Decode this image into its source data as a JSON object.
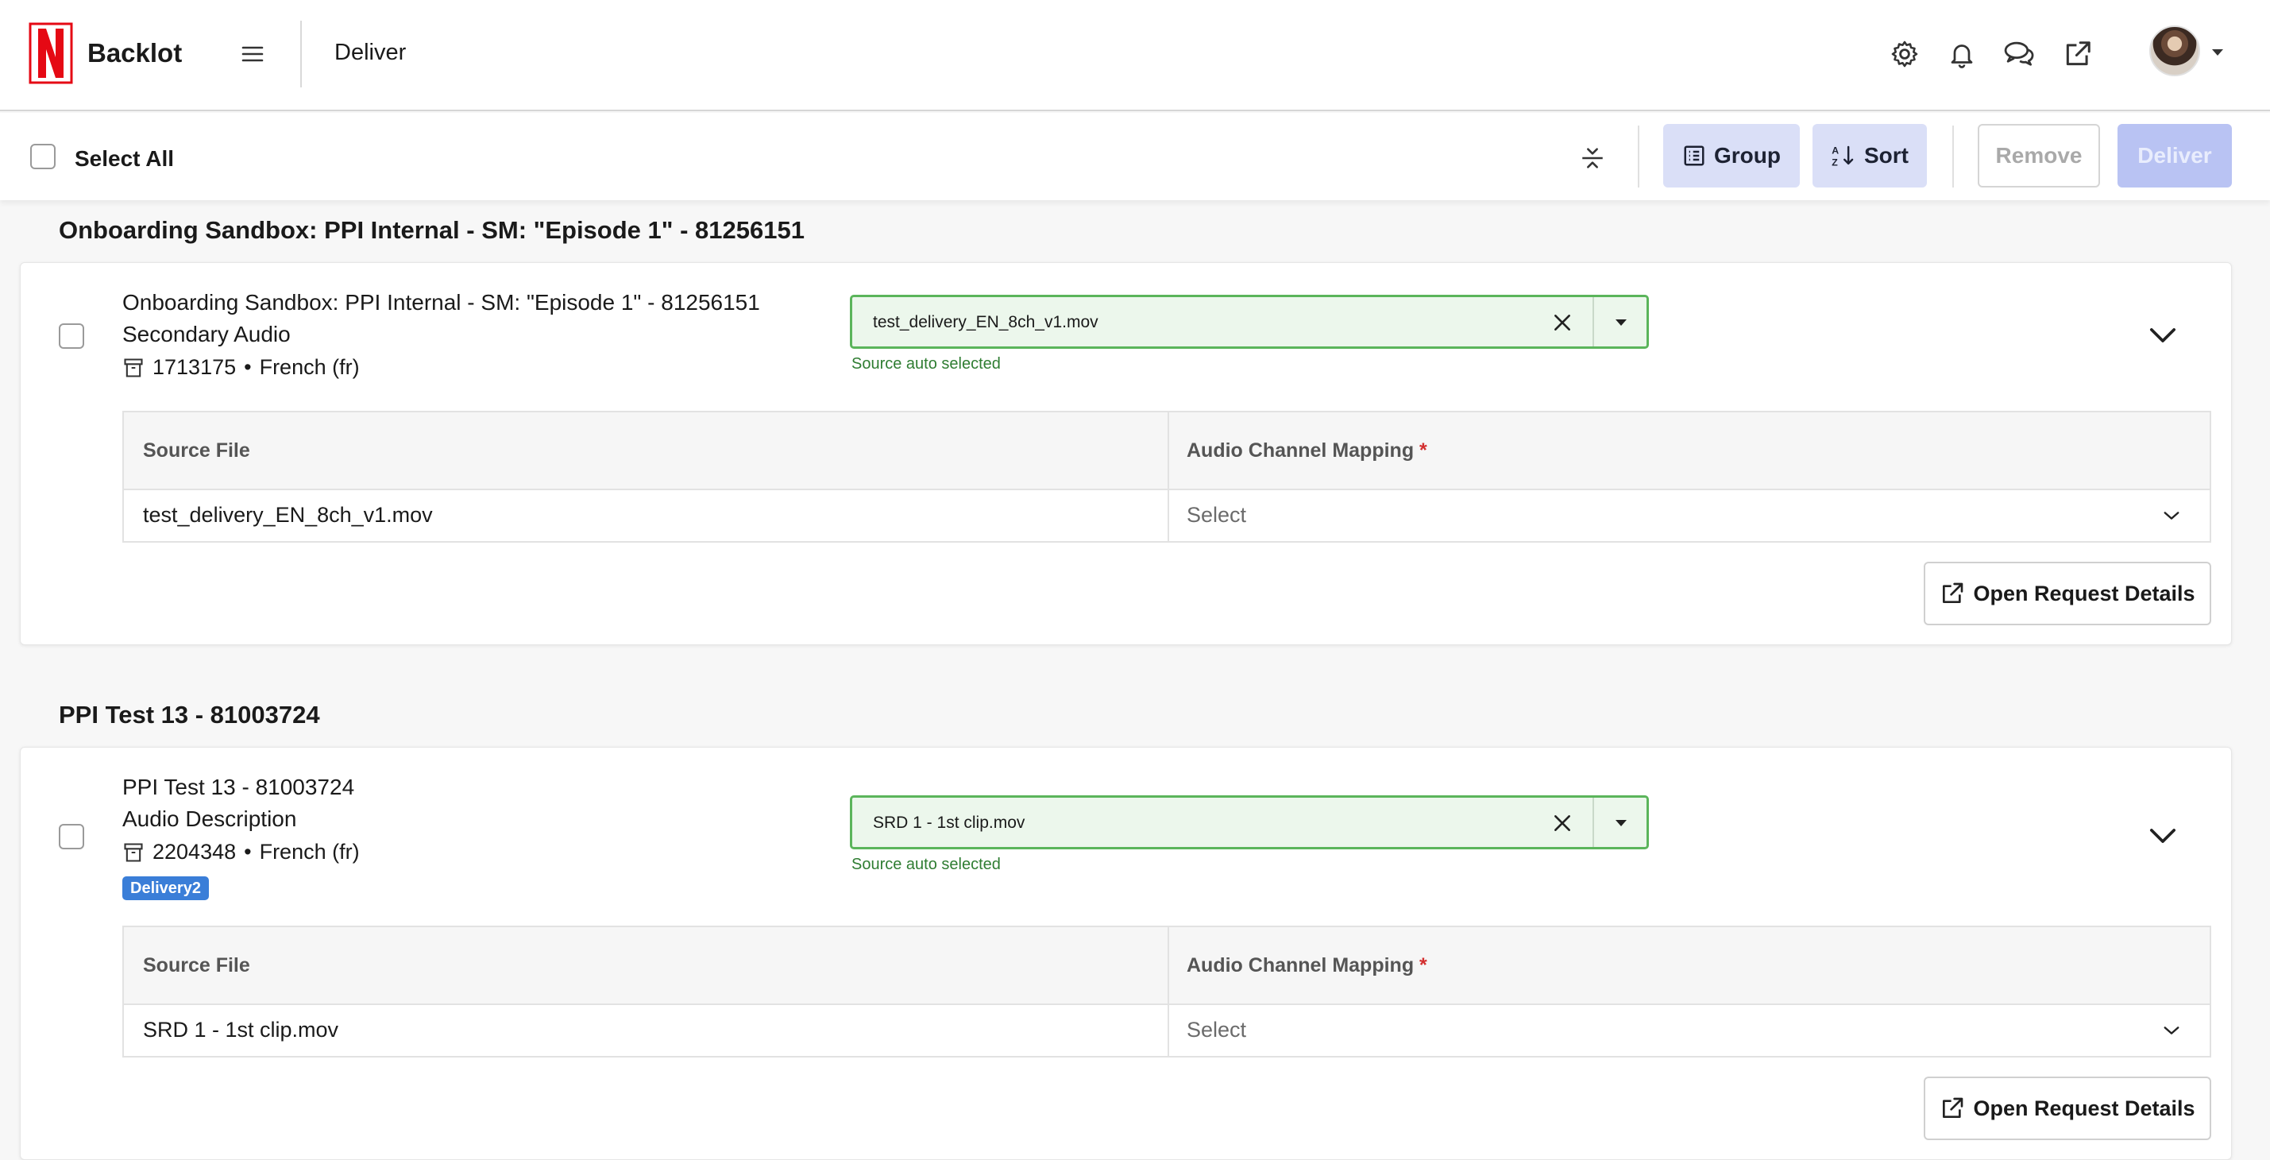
{
  "header": {
    "brand": "Backlot",
    "page_title": "Deliver",
    "icons": [
      "gear-icon",
      "bell-icon",
      "chat-icon",
      "external-link-icon"
    ],
    "brand_color": "#e50914"
  },
  "toolbar": {
    "select_all_label": "Select All",
    "group_label": "Group",
    "sort_label": "Sort",
    "remove_label": "Remove",
    "deliver_label": "Deliver"
  },
  "groups": [
    {
      "title": "Onboarding Sandbox: PPI Internal - SM: \"Episode 1\" - 81256151",
      "item": {
        "title": "Onboarding Sandbox: PPI Internal - SM: \"Episode 1\" - 81256151",
        "type": "Secondary Audio",
        "id": "1713175",
        "language": "French (fr)",
        "source_value": "test_delivery_EN_8ch_v1.mov",
        "source_hint": "Source auto selected",
        "table": {
          "col_source": "Source File",
          "col_mapping": "Audio Channel Mapping",
          "required_mark": "*",
          "source_file": "test_delivery_EN_8ch_v1.mov",
          "mapping_placeholder": "Select"
        },
        "open_details_label": "Open Request Details"
      }
    },
    {
      "title": "PPI Test 13 - 81003724",
      "item": {
        "title": "PPI Test 13 - 81003724",
        "type": "Audio Description",
        "id": "2204348",
        "language": "French (fr)",
        "badge": "Delivery2",
        "source_value": "SRD 1 - 1st clip.mov",
        "source_hint": "Source auto selected",
        "table": {
          "col_source": "Source File",
          "col_mapping": "Audio Channel Mapping",
          "required_mark": "*",
          "source_file": "SRD 1 - 1st clip.mov",
          "mapping_placeholder": "Select"
        },
        "open_details_label": "Open Request Details"
      }
    }
  ]
}
